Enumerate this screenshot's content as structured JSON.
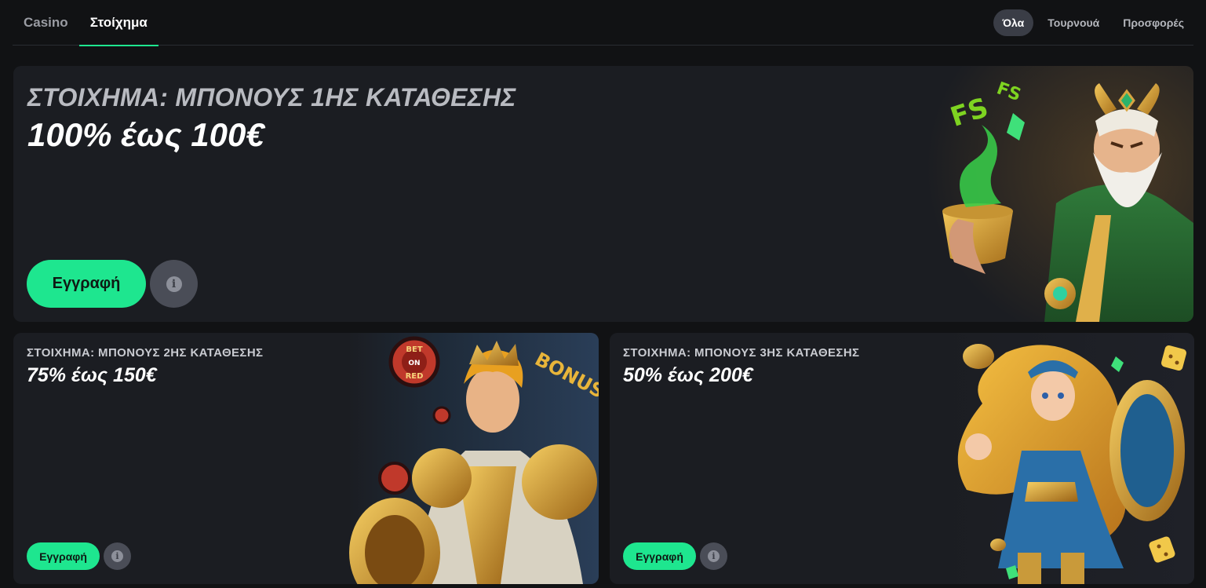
{
  "nav": {
    "main_tabs": [
      {
        "label": "Casino",
        "active": false
      },
      {
        "label": "Στοίχημα",
        "active": true
      }
    ],
    "filter_tabs": [
      {
        "label": "Όλα",
        "active": true
      },
      {
        "label": "Τουρνουά",
        "active": false
      },
      {
        "label": "Προσφορές",
        "active": false
      }
    ]
  },
  "promos": {
    "hero": {
      "kicker": "ΣΤΟΙΧΗΜΑ: ΜΠΟΝΟΥΣ 1ΗΣ ΚΑΤΑΘΕΣΗΣ",
      "headline": "100% έως 100€",
      "cta_label": "Εγγραφή",
      "info_icon": "info-icon",
      "art": {
        "icon": "wizard-illustration",
        "badge_text": [
          "FS",
          "FS"
        ]
      }
    },
    "left": {
      "kicker": "ΣΤΟΙΧΗΜΑ: ΜΠΟΝΟΥΣ 2ΗΣ ΚΑΤΑΘΕΣΗΣ",
      "headline": "75% έως 150€",
      "cta_label": "Εγγραφή",
      "info_icon": "info-icon",
      "art": {
        "icon": "knight-illustration",
        "chip_text": [
          "BET",
          "ON",
          "RED"
        ],
        "bonus_text": "BONUS"
      }
    },
    "right": {
      "kicker": "ΣΤΟΙΧΗΜΑ: ΜΠΟΝΟΥΣ 3ΗΣ ΚΑΤΑΘΕΣΗΣ",
      "headline": "50% έως 200€",
      "cta_label": "Εγγραφή",
      "info_icon": "info-icon",
      "art": {
        "icon": "warrior-girl-illustration"
      }
    }
  },
  "colors": {
    "accent": "#1ee68f",
    "background": "#111214",
    "card": "#1b1d22",
    "info_button": "#4a4d57"
  }
}
